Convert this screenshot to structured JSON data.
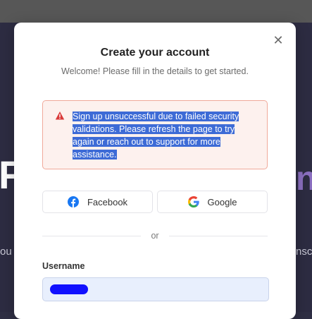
{
  "modal": {
    "title": "Create your account",
    "subtitle": "Welcome! Please fill in the details to get started.",
    "close_icon": "close-icon"
  },
  "alert": {
    "icon": "warning-triangle-icon",
    "message": "Sign up unsuccessful due to failed security validations. Please refresh the page to try again or reach out to support for more assistance.",
    "selected": true
  },
  "social": {
    "facebook_label": "Facebook",
    "google_label": "Google"
  },
  "divider": {
    "label": "or"
  },
  "username": {
    "label": "Username",
    "value_redacted": true
  },
  "colors": {
    "modal_bg": "#ffffff",
    "alert_bg": "#fdf1ee",
    "alert_border": "#f0a99a",
    "alert_icon": "#d93a3a",
    "selection": "#3d6bd6",
    "facebook_blue": "#1877f2",
    "input_bg": "#e8effd"
  },
  "background": {
    "left_glyph": "F",
    "right_glyph": "n",
    "left_text": "ou",
    "right_text": "nsc"
  }
}
